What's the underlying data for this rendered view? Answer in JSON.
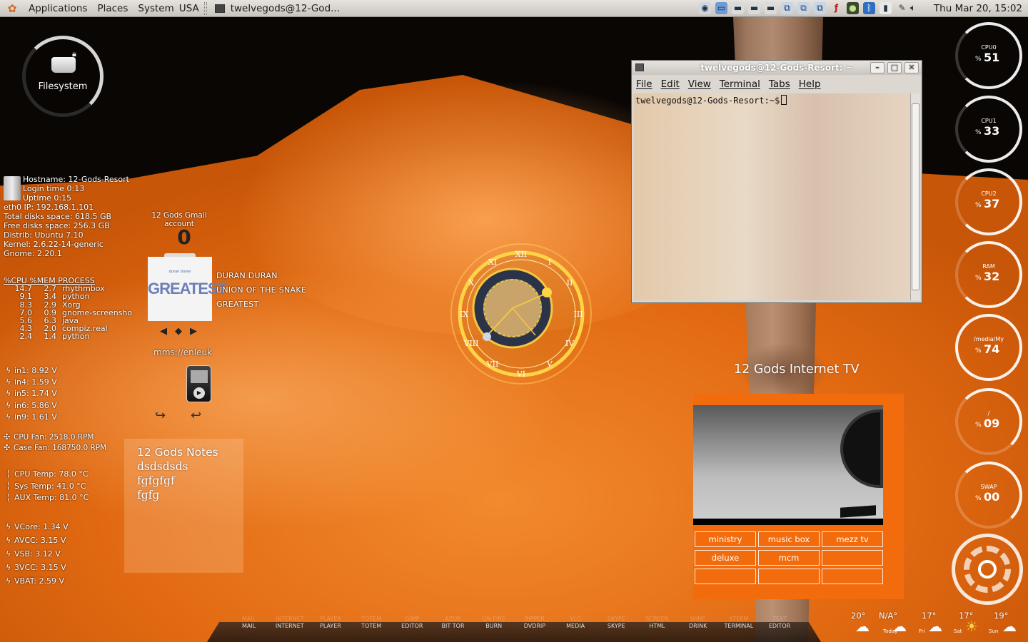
{
  "top_panel": {
    "menus": [
      "Applications",
      "Places",
      "System",
      "USA"
    ],
    "task_title": "twelvegods@12-God...",
    "clock": "Thu Mar 20, 15:02"
  },
  "filesystem": {
    "label": "Filesystem"
  },
  "sysinfo": {
    "hostname": "Hostname: 12-Gods-Resort",
    "login": "Login time 0:13",
    "uptime": "Uptime 0:15",
    "ip": "eth0 IP: 192.168.1.101",
    "total_disk": "Total disks space: 618.5 GB",
    "free_disk": "Free disks space: 256.3 GB",
    "distrib": "Distrib: Ubuntu 7.10",
    "kernel": "Kernel: 2.6.22-14-generic",
    "gnome": "Gnome: 2.20.1"
  },
  "processes": {
    "header": "%CPU %MEM PROCESS",
    "rows": [
      {
        "cpu": "14.7",
        "mem": "2.7",
        "name": "rhythmbox"
      },
      {
        "cpu": "9.1",
        "mem": "3.4",
        "name": "python"
      },
      {
        "cpu": "8.3",
        "mem": "2.9",
        "name": "Xorg"
      },
      {
        "cpu": "7.0",
        "mem": "0.9",
        "name": "gnome-screensho"
      },
      {
        "cpu": "5.6",
        "mem": "6.3",
        "name": "java"
      },
      {
        "cpu": "4.3",
        "mem": "2.0",
        "name": "compiz.real"
      },
      {
        "cpu": "2.4",
        "mem": "1.4",
        "name": "python"
      }
    ]
  },
  "voltages_in": [
    "in1: 8.92 V",
    "in4: 1.59 V",
    "in5: 1.74 V",
    "in6: 5.86 V",
    "in9: 1.61 V"
  ],
  "fans": [
    "CPU Fan: 2518.0 RPM",
    "Case Fan: 168750.0 RPM"
  ],
  "temps": [
    "CPU Temp: 78.0 °C",
    "Sys Temp:  41.0 °C",
    "AUX Temp: 81.0 °C"
  ],
  "voltages_core": [
    "VCore: 1.34 V",
    "AVCC: 3.15 V",
    "VSB: 3.12 V",
    "3VCC: 3.15 V",
    "VBAT: 2.59 V"
  ],
  "gmail": {
    "label": "12 Gods Gmail account",
    "count": "0"
  },
  "music": {
    "artist": "DURAN DURAN",
    "song": "UNION OF THE SNAKE",
    "album": "GREATEST",
    "cover_text": "GREATEST",
    "cover_small": "duran duran",
    "stream": "mms://enleuk"
  },
  "notes": {
    "title": "12 Gods Notes",
    "lines": [
      "dsdsdsds",
      "fgfgfgf",
      "fgfg"
    ]
  },
  "terminal": {
    "title": "twelvegods@12-Gods-Resort: ~",
    "menus": [
      "File",
      "Edit",
      "View",
      "Terminal",
      "Tabs",
      "Help"
    ],
    "prompt": "twelvegods@12-Gods-Resort:~$"
  },
  "meters": [
    {
      "label": "CPU0",
      "value": "51"
    },
    {
      "label": "CPU1",
      "value": "33"
    },
    {
      "label": "CPU2",
      "value": "37"
    },
    {
      "label": "RAM",
      "value": "32"
    },
    {
      "label": "/media/My",
      "value": "74"
    },
    {
      "label": "/",
      "value": "09"
    },
    {
      "label": "SWAP",
      "value": "00"
    }
  ],
  "meter_unit": "%",
  "tv": {
    "title": "12 Gods Internet TV",
    "channels": [
      "ministry",
      "music box",
      "mezz tv",
      "deluxe",
      "mcm",
      "",
      "",
      "",
      ""
    ]
  },
  "dock": {
    "items": [
      {
        "top": "MAIL",
        "bottom": "MAIL"
      },
      {
        "top": "INTERNET",
        "bottom": "INTERNET"
      },
      {
        "top": "PLAYER",
        "bottom": "PLAYER"
      },
      {
        "top": "TOTEM",
        "bottom": "TOTEM"
      },
      {
        "top": "GIMP",
        "bottom": "EDITOR"
      },
      {
        "top": "AZUR",
        "bottom": "BIT TOR"
      },
      {
        "top": "ON FIRE",
        "bottom": "BURN"
      },
      {
        "top": "RIPPER",
        "bottom": "DVDRIP"
      },
      {
        "top": "VLC",
        "bottom": "MEDIA"
      },
      {
        "top": "SKYPE",
        "bottom": "SKYPE"
      },
      {
        "top": "SCREEN",
        "bottom": "HTML"
      },
      {
        "top": "WINE",
        "bottom": "DRINK"
      },
      {
        "top": "XTERM",
        "bottom": "TERMINAL"
      },
      {
        "top": "TEXT",
        "bottom": "EDITOR"
      }
    ]
  },
  "weather": {
    "current": "20°",
    "today": "N/A°",
    "today_label": "Today",
    "fri": "17°",
    "fri_label": "Fri",
    "sat": "17°",
    "sat_label": "Sat",
    "sun": "19°",
    "sun_label": "Sun"
  }
}
